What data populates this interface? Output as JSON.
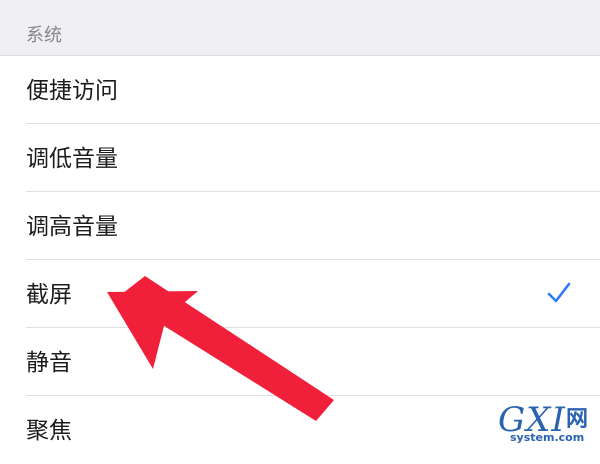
{
  "section": {
    "title": "系统"
  },
  "items": [
    {
      "label": "便捷访问",
      "selected": false
    },
    {
      "label": "调低音量",
      "selected": false
    },
    {
      "label": "调高音量",
      "selected": false
    },
    {
      "label": "截屏",
      "selected": true
    },
    {
      "label": "静音",
      "selected": false
    },
    {
      "label": "聚焦",
      "selected": false
    }
  ],
  "icons": {
    "selected": "checkmark-icon",
    "annotation": "red-arrow-annotation"
  },
  "colors": {
    "accent": "#2f7bf6",
    "arrow": "#f0203a",
    "header_bg": "#efeff4"
  },
  "watermark": {
    "letters": "GXI",
    "suffix": "网",
    "domain": "system.com"
  }
}
